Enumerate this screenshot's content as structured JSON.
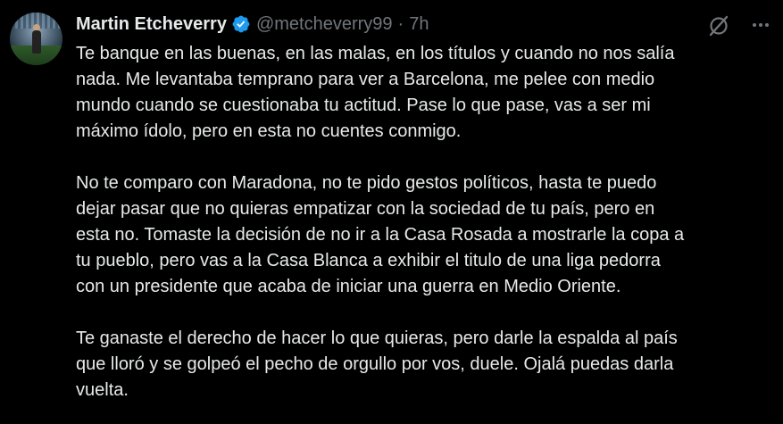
{
  "author": {
    "name": "Martin Etcheverry",
    "handle": "@metcheverry99",
    "separator": "·",
    "time": "7h",
    "verified_color": "#1d9bf0"
  },
  "icons": {
    "grok": "grok-icon",
    "more": "more-icon"
  },
  "tweet": {
    "paragraphs": [
      "Te banque en las buenas, en las malas, en los títulos y cuando no nos salía\nnada. Me levantaba temprano para ver a Barcelona, me pelee con medio\nmundo cuando se cuestionaba tu actitud. Pase lo que pase, vas a ser mi\nmáximo ídolo, pero en esta no cuentes conmigo.",
      "No te comparo con Maradona, no te pido gestos políticos, hasta te puedo\ndejar pasar que no quieras empatizar con la sociedad de tu país, pero en\nesta no. Tomaste la decisión de no ir a la Casa Rosada a mostrarle la copa a\ntu pueblo, pero vas a la Casa Blanca a exhibir el titulo de una liga pedorra\ncon un presidente que acaba de iniciar una guerra en Medio Oriente.",
      "Te ganaste el derecho de hacer lo que quieras, pero darle la espalda al país\nque lloró y se golpeó el pecho de orgullo por vos, duele. Ojalá puedas darla\nvuelta."
    ]
  },
  "colors": {
    "background": "#000000",
    "text": "#e7e9ea",
    "secondary": "#71767b"
  }
}
